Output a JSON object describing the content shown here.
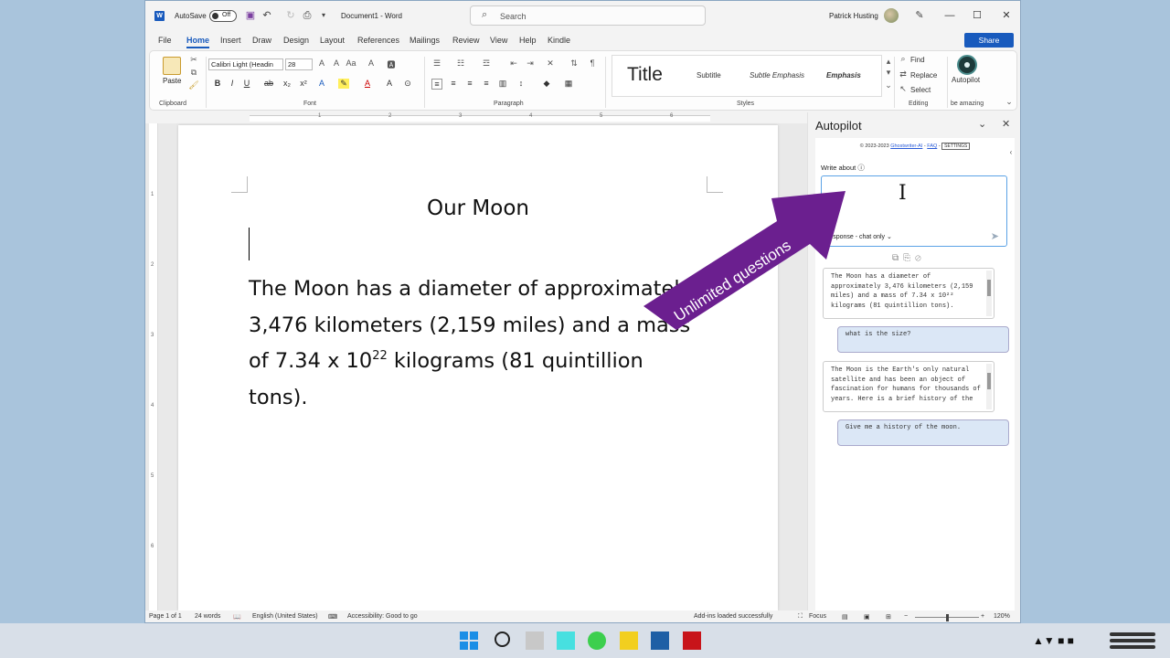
{
  "titlebar": {
    "app_icon": "W",
    "autosave_label": "AutoSave",
    "autosave_state": "Off",
    "document_title": "Document1  -  Word",
    "search_placeholder": "Search",
    "user_name": "Patrick Husting"
  },
  "menu": {
    "tabs": [
      "File",
      "Home",
      "Insert",
      "Draw",
      "Design",
      "Layout",
      "References",
      "Mailings",
      "Review",
      "View",
      "Help",
      "Kindle"
    ],
    "active_tab": "Home",
    "share_label": "Share"
  },
  "ribbon": {
    "clipboard": {
      "paste_label": "Paste",
      "group_label": "Clipboard"
    },
    "font": {
      "font_name": "Calibri Light (Headin",
      "font_size": "28",
      "group_label": "Font"
    },
    "paragraph": {
      "group_label": "Paragraph"
    },
    "styles": {
      "items": [
        "Title",
        "Subtitle",
        "Subtle Emphasis",
        "Emphasis"
      ],
      "group_label": "Styles"
    },
    "editing": {
      "find": "Find",
      "replace": "Replace",
      "select": "Select",
      "group_label": "Editing"
    },
    "autopilot": {
      "button_label": "Autopilot",
      "group_label": "be amazing"
    }
  },
  "ruler_numbers": [
    "1",
    "2",
    "3",
    "4",
    "5",
    "6"
  ],
  "vruler_numbers": [
    "1",
    "2",
    "3",
    "4",
    "5",
    "6"
  ],
  "document": {
    "title": "Our Moon",
    "body_part1": "The Moon has a diameter of approximately 3,476 kilometers (2,159 miles) and a mass of 7.34 x 10",
    "body_sup": "22",
    "body_part2": " kilograms (81 quintillion tons)."
  },
  "pane": {
    "title": "Autopilot",
    "copyright_prefix": "© 2023-2023",
    "copyright_link": "Ghostwriter-AI",
    "faq": "FAQ",
    "settings": "SETTINGS",
    "write_about_label": "Write about",
    "response_mode": "response - chat only",
    "conversation": [
      {
        "role": "answer",
        "text": "The Moon has a diameter of approximately 3,476 kilometers (2,159 miles) and a mass of 7.34 x 10²² kilograms (81 quintillion tons)."
      },
      {
        "role": "question",
        "text": "what is the size?"
      },
      {
        "role": "answer",
        "text": "The Moon is the Earth's only natural satellite and has been an object of fascination for humans for thousands of years. Here is a brief history of the"
      },
      {
        "role": "question",
        "text": "Give me a history of the moon."
      }
    ]
  },
  "annotation": {
    "text": "Unlimited questions",
    "color": "#6b1f8f"
  },
  "statusbar": {
    "page": "Page 1 of 1",
    "words": "24 words",
    "language": "English (United States)",
    "accessibility": "Accessibility: Good to go",
    "addins": "Add-ins loaded successfully",
    "focus": "Focus",
    "zoom": "120%"
  },
  "colors": {
    "accent": "#185abd",
    "arrow": "#6b1f8f",
    "desktop": "#a9c4dc"
  }
}
